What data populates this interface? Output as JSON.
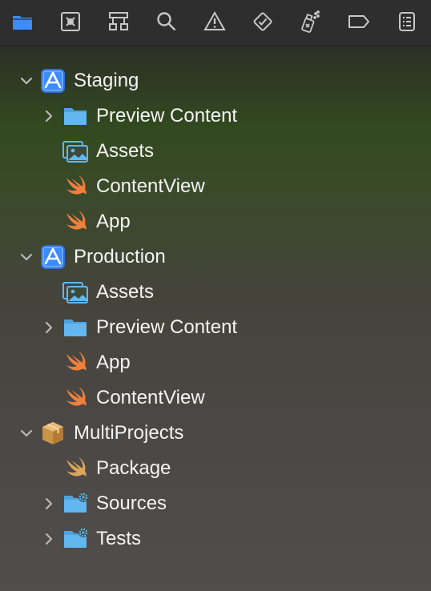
{
  "toolbar": {
    "items": [
      {
        "icon": "folder-icon",
        "selected": true
      },
      {
        "icon": "source-control-icon"
      },
      {
        "icon": "symbol-hierarchy-icon"
      },
      {
        "icon": "search-icon"
      },
      {
        "icon": "warning-triangle-icon"
      },
      {
        "icon": "test-diamond-icon"
      },
      {
        "icon": "debug-spray-icon"
      },
      {
        "icon": "breakpoint-tag-icon"
      },
      {
        "icon": "report-list-icon"
      }
    ],
    "accent": "#3d8bff"
  },
  "tree": {
    "items": [
      {
        "label": "Staging",
        "icon": "app-project-icon",
        "disclosure": "expanded"
      },
      {
        "label": "Preview Content",
        "icon": "folder-icon",
        "disclosure": "collapsed"
      },
      {
        "label": "Assets",
        "icon": "asset-catalog-icon",
        "disclosure": "none"
      },
      {
        "label": "ContentView",
        "icon": "swift-file-icon",
        "disclosure": "none"
      },
      {
        "label": "App",
        "icon": "swift-file-icon",
        "disclosure": "none"
      },
      {
        "label": "Production",
        "icon": "app-project-icon",
        "disclosure": "expanded"
      },
      {
        "label": "Assets",
        "icon": "asset-catalog-icon",
        "disclosure": "none"
      },
      {
        "label": "Preview Content",
        "icon": "folder-icon",
        "disclosure": "collapsed"
      },
      {
        "label": "App",
        "icon": "swift-file-icon",
        "disclosure": "none"
      },
      {
        "label": "ContentView",
        "icon": "swift-file-icon",
        "disclosure": "none"
      },
      {
        "label": "MultiProjects",
        "icon": "package-icon",
        "disclosure": "expanded"
      },
      {
        "label": "Package",
        "icon": "swift-package-manifest-icon",
        "disclosure": "none"
      },
      {
        "label": "Sources",
        "icon": "gear-folder-icon",
        "disclosure": "collapsed"
      },
      {
        "label": "Tests",
        "icon": "gear-folder-icon",
        "disclosure": "collapsed"
      }
    ]
  },
  "colors": {
    "folder": "#62b7f0",
    "swift": "#f0803c",
    "app_icon": "#3d8bff",
    "package": "#d9a55a",
    "chevron": "#b9b9b9"
  }
}
